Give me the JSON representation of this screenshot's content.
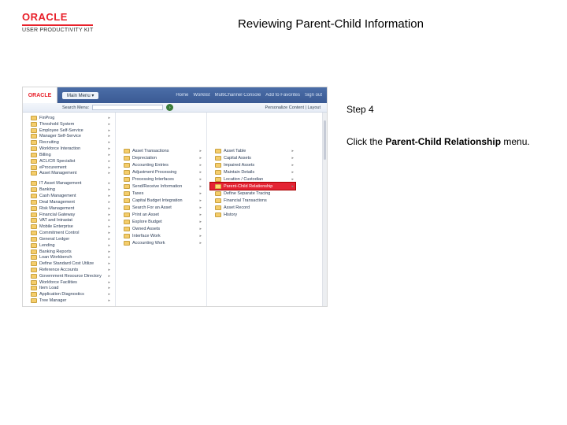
{
  "brand": {
    "name": "ORACLE",
    "sub": "USER PRODUCTIVITY KIT"
  },
  "page_title": "Reviewing Parent-Child Information",
  "instruction": {
    "step_label": "Step 4",
    "text_prefix": "Click the ",
    "bold": "Parent-Child Relationship",
    "text_suffix": " menu."
  },
  "screenshot": {
    "top_logo": "ORACLE",
    "crumb": "Main Menu",
    "top_nav": [
      "Home",
      "Worklist",
      "MultiChannel Console",
      "Add to Favorites",
      "Sign out"
    ],
    "search_label": "Search Menu:",
    "go_glyph": "›",
    "personalize": "Personalize Content | Layout",
    "col1": [
      "FinProg",
      "Threshold System",
      "Employee Self-Service",
      "Manager Self-Service",
      "Recruiting",
      "Workforce Interaction",
      "Billing",
      "ACL/CR Specialist",
      "eProcurement",
      "Asset Management"
    ],
    "col1b": [
      "IT Asset Management",
      "Banking",
      "Cash Management",
      "Deal Management",
      "Risk Management",
      "Financial Gateway",
      "VAT and Intrastat",
      "Mobile Enterprise",
      "Commitment Control",
      "General Ledger",
      "Lending",
      "Banking Reports",
      "Loan Workbench",
      "Define Standard Cost Utilize",
      "Reference Accounts",
      "Government Resource Directory",
      "Workforce Facilities",
      "Item Load",
      "Application Diagnostics",
      "Tree Manager"
    ],
    "col2": [
      "Asset Transactions",
      "Depreciation",
      "Accounting Entries",
      "Adjustment Processing",
      "Processing Interfaces",
      "Send/Receive Information",
      "Taxes",
      "Capital Budget Integration",
      "Search For an Asset",
      "Print an Asset",
      "Explore Budget",
      "Owned Assets",
      "Interface Work",
      "Accounting Work"
    ],
    "col3": [
      "Asset Table",
      "Capital Assets",
      "Impaired Assets",
      "Maintain Details",
      "Location / Custodian",
      "Parent-Child Relationship",
      "Define Separate Tracing",
      "Financial Transactions",
      "Asset Record",
      "History"
    ],
    "highlight_index": 5
  }
}
